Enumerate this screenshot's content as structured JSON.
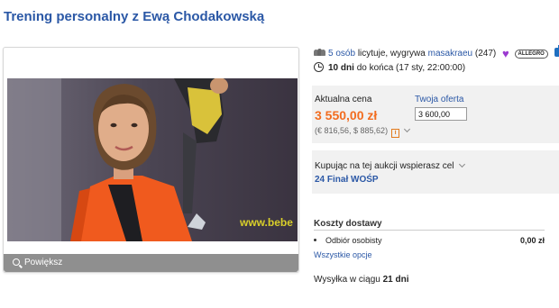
{
  "title": "Trening personalny z Ewą Chodakowską",
  "image": {
    "zoom_label": "Powiększ",
    "overlay_text": "www.bebe"
  },
  "bidders": {
    "count_link": "5 osób",
    "text": "licytuje, wygrywa",
    "winner": "masakraeu",
    "winner_score": "(247)",
    "badge": "ALLEGRO"
  },
  "time": {
    "remaining": "10 dni",
    "text": "do końca (17 sty, 22:00:00)"
  },
  "price": {
    "label": "Aktualna cena",
    "value": "3 550,00 zł",
    "conversion": "(€ 816,56, $ 885,62)"
  },
  "offer": {
    "label": "Twoja oferta",
    "value": "3 600,00"
  },
  "charity": {
    "label": "Kupując na tej aukcji wspierasz cel",
    "name": "24 Finał WOŚP"
  },
  "shipping": {
    "title": "Koszty dostawy",
    "method": "Odbiór osobisty",
    "cost": "0,00 zł",
    "all_options": "Wszystkie opcje"
  },
  "delivery": {
    "prefix": "Wysyłka w ciągu",
    "days": "21 dni"
  },
  "colors": {
    "link": "#2b58a6",
    "price": "#f26c1f",
    "panel_bg": "#f1f1f1"
  }
}
